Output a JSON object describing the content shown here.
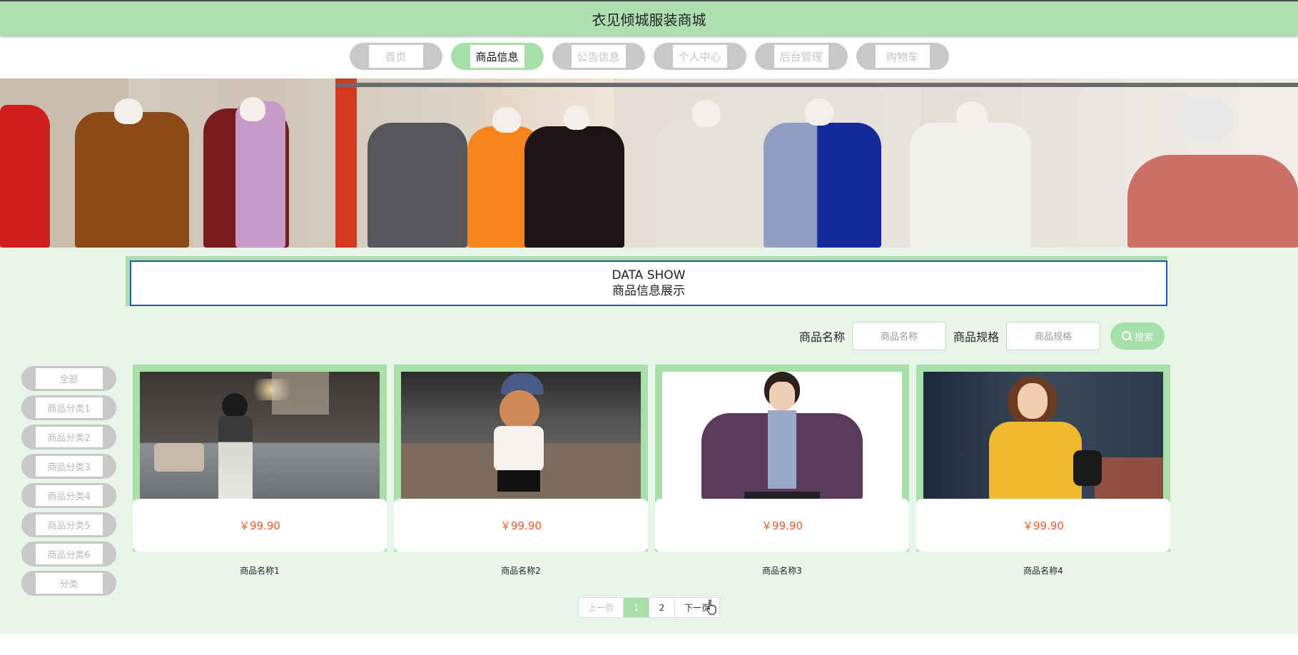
{
  "header": {
    "title": "衣见倾城服装商城"
  },
  "nav": {
    "items": [
      {
        "label": "首页",
        "active": false
      },
      {
        "label": "商品信息",
        "active": true
      },
      {
        "label": "公告信息",
        "active": false
      },
      {
        "label": "个人中心",
        "active": false
      },
      {
        "label": "后台管理",
        "active": false
      },
      {
        "label": "购物车",
        "active": false
      }
    ]
  },
  "section": {
    "title_en": "DATA SHOW",
    "title_cn": "商品信息展示"
  },
  "search": {
    "name_label": "商品名称",
    "name_placeholder": "商品名称",
    "spec_label": "商品规格",
    "spec_placeholder": "商品规格",
    "button_label": "搜索"
  },
  "categories": [
    "全部",
    "商品分类1",
    "商品分类2",
    "商品分类3",
    "商品分类4",
    "商品分类5",
    "商品分类6",
    "分类"
  ],
  "products": [
    {
      "price": "￥99.90",
      "name": "商品名称1"
    },
    {
      "price": "￥99.90",
      "name": "商品名称2"
    },
    {
      "price": "￥99.90",
      "name": "商品名称3"
    },
    {
      "price": "￥99.90",
      "name": "商品名称4"
    }
  ],
  "pagination": {
    "prev": "上一页",
    "pages": [
      "1",
      "2"
    ],
    "current": "1",
    "next": "下一页"
  },
  "colors": {
    "accent": "#a6e0a8",
    "header": "#b0e0b2",
    "main_bg": "#e8f5e9",
    "price": "#f05a2a",
    "inactive": "#c8c8c8"
  }
}
